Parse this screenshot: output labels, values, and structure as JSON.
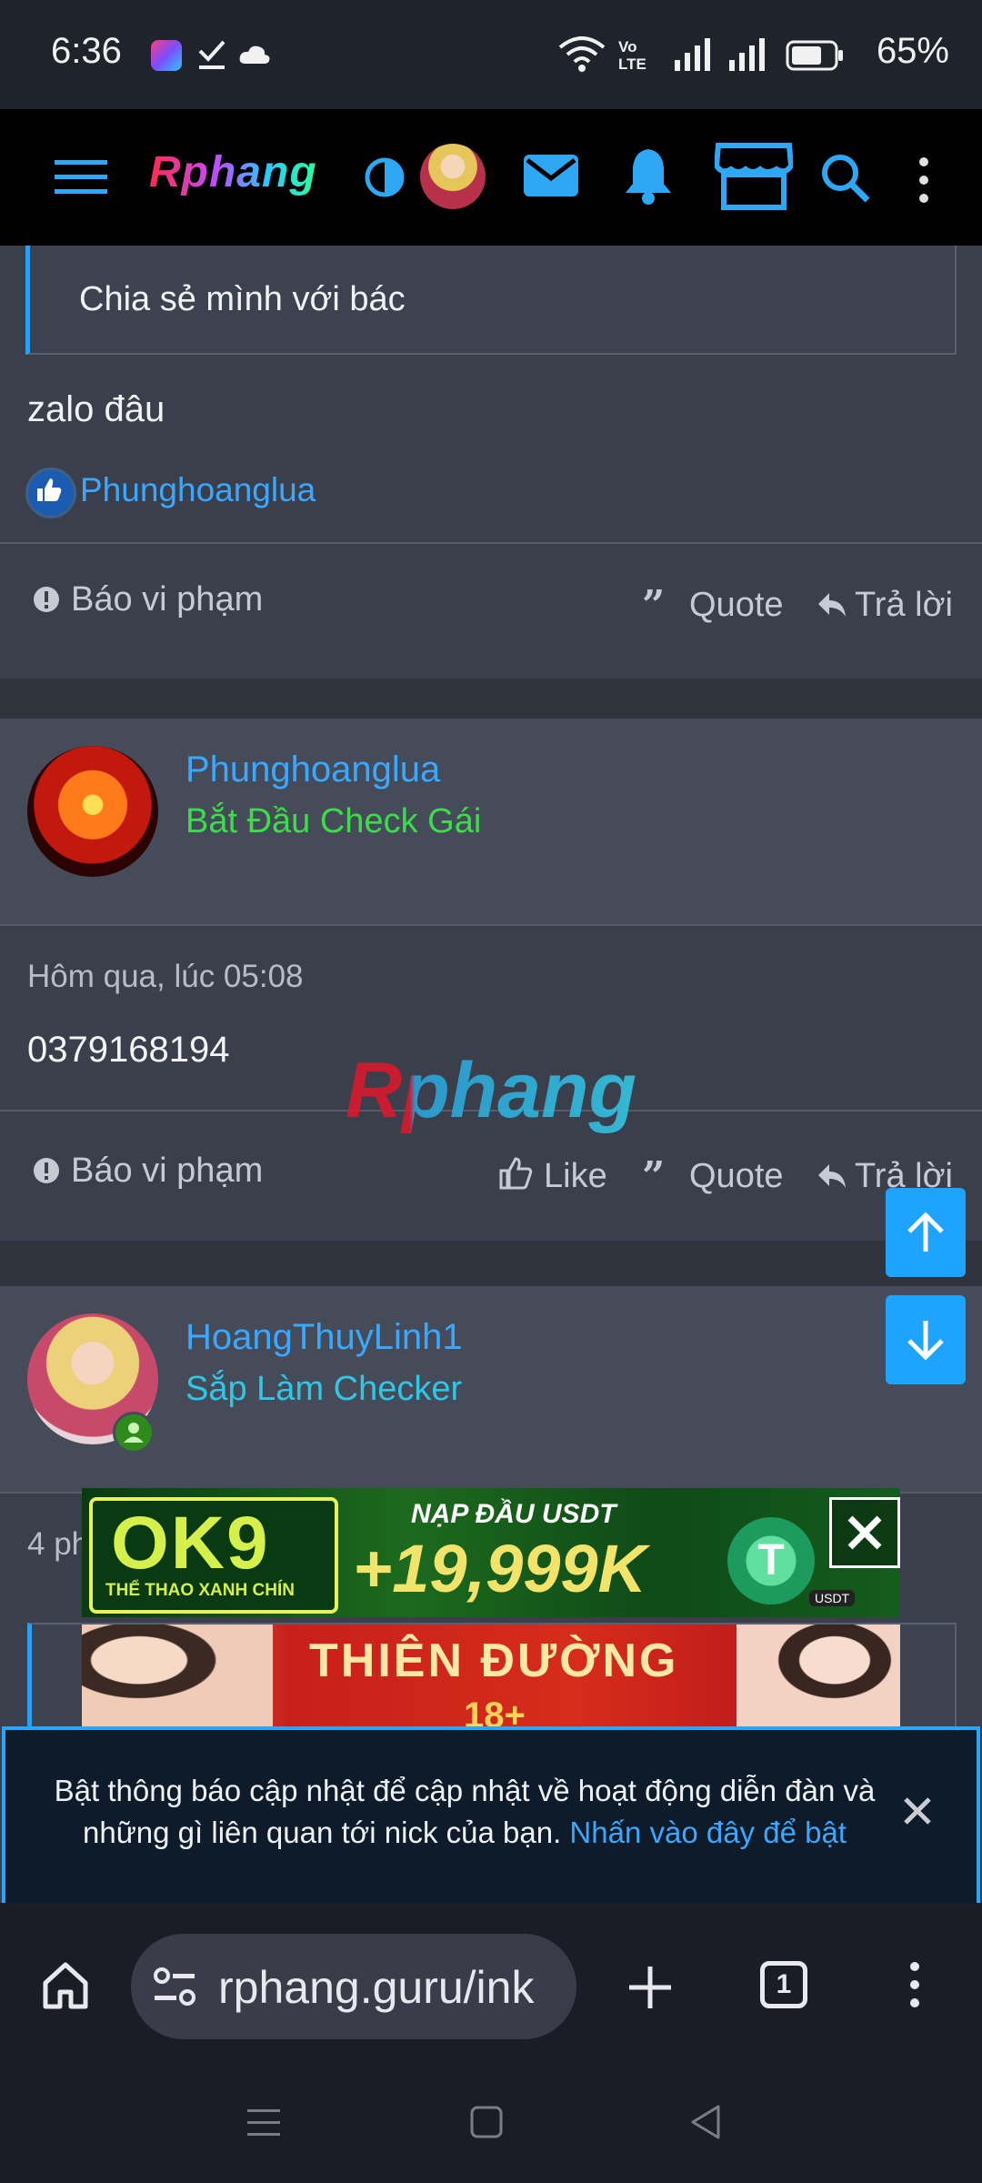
{
  "status_bar": {
    "time": "6:36",
    "network": "Vo LTE",
    "battery": "65%"
  },
  "app_header": {
    "logo": "Rphang"
  },
  "post1": {
    "quote_text": "Chia sẻ mình với bác",
    "body": "zalo đâu",
    "liked_by": "Phunghoanglua",
    "report_label": "Báo vi phạm",
    "quote_label": "Quote",
    "reply_label": "Trả lời"
  },
  "post2": {
    "username": "Phunghoanglua",
    "user_title": "Bắt Đầu Check Gái",
    "timestamp": "Hôm qua, lúc 05:08",
    "body": "0379168194",
    "report_label": "Báo vi phạm",
    "like_label": "Like",
    "quote_label": "Quote",
    "reply_label": "Trả lời"
  },
  "watermark": "Rphang",
  "post3": {
    "username": "HoangThuyLinh1",
    "user_title": "Sắp Làm Checker",
    "timestamp_partial": "4 ph"
  },
  "ads": {
    "ad1_brand": "OK9",
    "ad1_sub": "THỂ THAO XANH CHÍN",
    "ad1_headline": "NẠP ĐẦU USDT",
    "ad1_amount": "+19,999K",
    "ad1_badge": "USDT",
    "ad2_headline": "THIÊN ĐƯỜNG",
    "ad2_sub": "18+"
  },
  "notification": {
    "text": "Bật thông báo cập nhật để cập nhật về hoạt động diễn đàn và những gì liên quan tới nick của bạn.",
    "link": "Nhấn vào đây để bật"
  },
  "browser": {
    "url": "rphang.guru/ink",
    "tab_count": "1"
  },
  "colors": {
    "accent": "#1ea3ff",
    "user_title_green": "#3ddc4a",
    "user_title_cyan": "#2ec8e6",
    "link": "#3aa8ff"
  }
}
